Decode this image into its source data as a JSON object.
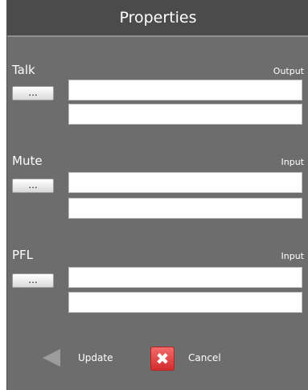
{
  "window": {
    "title": "Properties"
  },
  "sections": [
    {
      "title": "Talk",
      "type_label": "Output",
      "button_label": "..."
    },
    {
      "title": "Mute",
      "type_label": "Input",
      "button_label": "..."
    },
    {
      "title": "PFL",
      "type_label": "Input",
      "button_label": "..."
    }
  ],
  "footer": {
    "update_label": "Update",
    "update_icon": "left-arrow-icon",
    "cancel_label": "Cancel",
    "cancel_icon": "close-x-icon",
    "cancel_icon_glyph": "✖"
  },
  "colors": {
    "panel_bg": "#6d6d6d",
    "titlebar_bg": "#4b4b4b",
    "cancel_red": "#e03b3b"
  }
}
